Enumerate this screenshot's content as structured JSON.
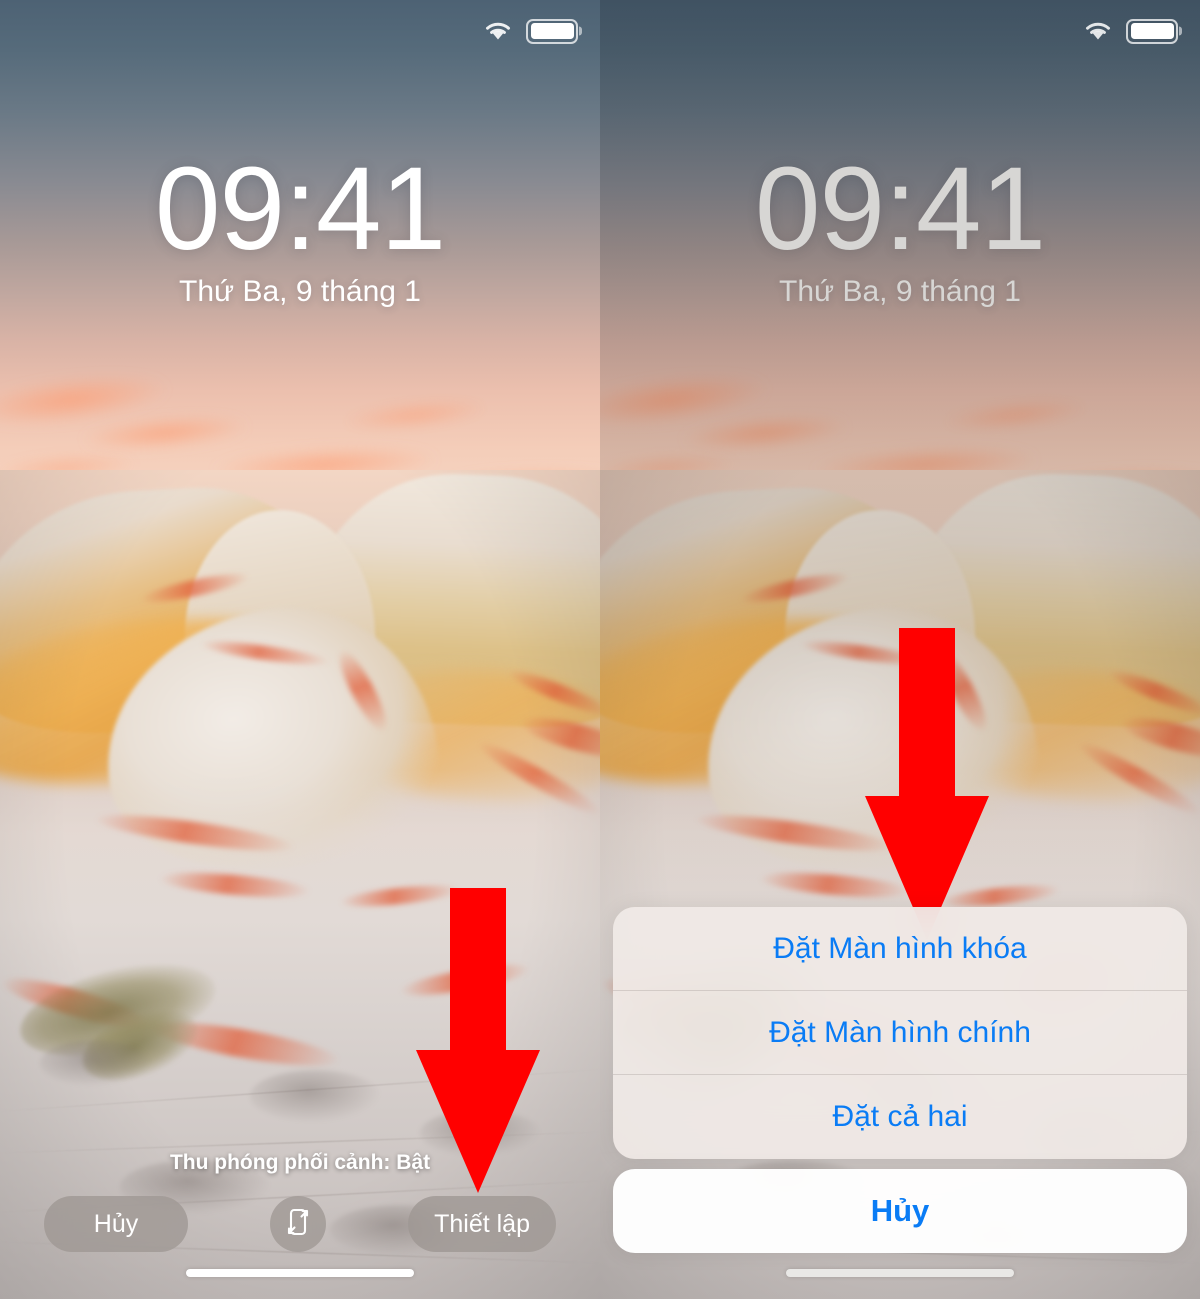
{
  "meta": {
    "description": "Vietnamese iOS wallpaper setup tutorial, two phone screenshots side by side"
  },
  "colors": {
    "arrow_red": "#FF0000",
    "ios_blue": "#0A7CF5",
    "pill_gray": "rgba(155,148,144,0.72)",
    "sheet_bg": "rgba(240,234,230,0.93)",
    "sky_top_left": "#4D6274",
    "sky_top_right": "#465A68"
  },
  "panels": [
    {
      "id": "left-panel",
      "status_bar": {
        "wifi_icon": "wifi-icon",
        "battery_icon": "battery-icon"
      },
      "lock_screen": {
        "time": "09:41",
        "date": "Thứ Ba, 9 tháng 1"
      },
      "perspective_zoom_label": "Thu phóng phối cảnh: Bật",
      "buttons": {
        "cancel": "Hủy",
        "perspective_toggle_icon": "perspective-zoom-icon",
        "set": "Thiết lập"
      },
      "annotation": {
        "arrow": "red-down-arrow",
        "points_to": "Thiết lập"
      }
    },
    {
      "id": "right-panel",
      "status_bar": {
        "wifi_icon": "wifi-icon",
        "battery_icon": "battery-icon"
      },
      "lock_screen": {
        "time": "09:41",
        "date": "Thứ Ba, 9 tháng 1"
      },
      "action_sheet": {
        "options": [
          "Đặt Màn hình khóa",
          "Đặt Màn hình chính",
          "Đặt cả hai"
        ],
        "cancel": "Hủy"
      },
      "annotation": {
        "arrow": "red-down-arrow",
        "points_to": "Đặt Màn hình khóa"
      }
    }
  ]
}
